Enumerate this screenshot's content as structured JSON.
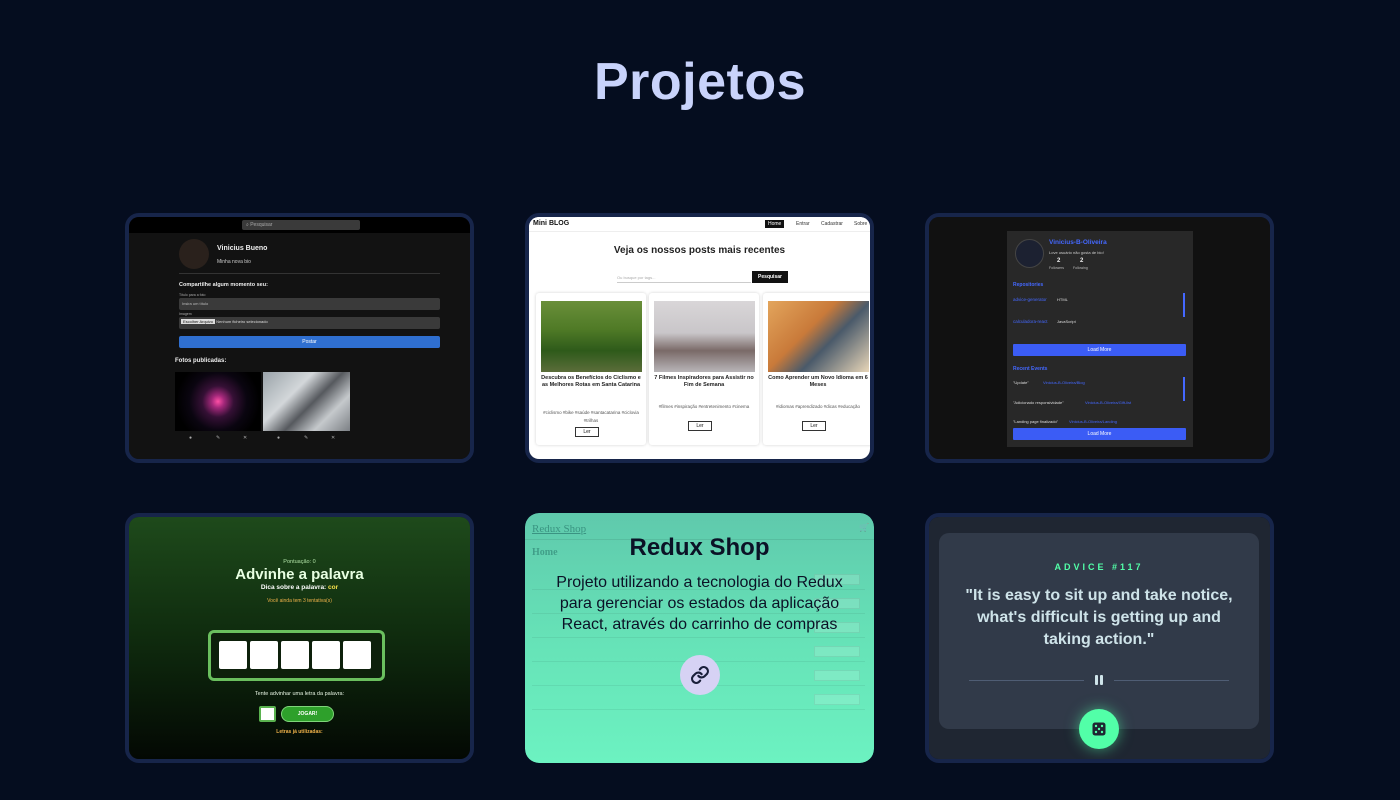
{
  "title": "Projetos",
  "projects": [
    {
      "profile_name": "Vinicius Bueno",
      "bio": "Minha nova bio",
      "search_placeholder": "Pesquisar",
      "share_heading": "Compartilhe algum momento seu:",
      "caption_label": "Título para a foto",
      "caption_placeholder": "Insira um título",
      "image_label": "Imagem",
      "file_button": "Escolher Arquivo",
      "file_status": "Nenhum ficheiro selecionado",
      "post_button": "Postar",
      "published_heading": "Fotos publicadas:"
    },
    {
      "brand": "Mini BLOG",
      "nav": [
        "Home",
        "Entrar",
        "Cadastrar",
        "Sobre"
      ],
      "heading": "Veja os nossos posts mais recentes",
      "search_placeholder": "Ou busque por tags...",
      "search_button": "Pesquisar",
      "read_label": "Ler",
      "posts": [
        {
          "title": "Descubra os Benefícios do Ciclismo e as Melhores Rotas em Santa Catarina",
          "tags": "#ciclismo #bike #saúde #santacatarina #ciclovia #trilhas"
        },
        {
          "title": "7 Filmes Inspiradores para Assistir no Fim de Semana",
          "tags": "#filmes #inspiração #entretenimento #cinema"
        },
        {
          "title": "Como Aprender um Novo Idioma em 6 Meses",
          "tags": "#idiomas #aprendizado #dicas #educação"
        }
      ]
    },
    {
      "username": "Vinicius-B-Oliveira",
      "bio": "Love usuário não gosta de bio!",
      "followers_count": "2",
      "followers_label": "Followers",
      "following_count": "2",
      "following_label": "Following",
      "repos_heading": "Repositories",
      "repos": [
        {
          "name": "advice-generator",
          "lang": "HTML"
        },
        {
          "name": "calculadora-react",
          "lang": "JavaScript"
        }
      ],
      "load_more": "Load More",
      "events_heading": "Recent Events",
      "events": [
        {
          "message": "\"Update\"",
          "repo": "Vinicius-B-Oliveira/Blog"
        },
        {
          "message": "\"Adicionado responsividade\"",
          "repo": "Vinicius-B-Oliveira/Gift-list"
        },
        {
          "message": "\"Landing page finalizado\"",
          "repo": "Vinicius-B-Oliveira/Landing"
        }
      ]
    },
    {
      "score": "Pontuação: 0",
      "heading": "Advinhe a palavra",
      "hint_label": "Dica sobre a palavra:",
      "hint_value": "cor",
      "attempts": "Você ainda tem 3 tentativa(s)",
      "guess_label": "Tente advinhar uma letra da palavra:",
      "play_button": "JOGAR!",
      "used_letters": "Letras já utilizadas:"
    },
    {
      "app_name": "Redux Shop",
      "page": "Home",
      "overlay_title": "Redux Shop",
      "overlay_desc": "Projeto utilizando a tecnologia do Redux para gerenciar os estados da aplicação React, através do carrinho de compras"
    },
    {
      "advice_number": "ADVICE #117",
      "quote": "\"It is easy to sit up and take notice, what's difficult is getting up and taking action.\""
    }
  ],
  "colors": {
    "background": "#050d1f",
    "title": "#c9d3fb",
    "card_border": "#17254a",
    "advice_accent": "#52ffa8",
    "github_link": "#4468ff",
    "redux_overlay": "#66e2b7"
  },
  "icons": [
    "search-icon",
    "eye-icon",
    "pencil-icon",
    "close-icon",
    "link-icon",
    "dice-icon",
    "pause-icon",
    "cart-icon"
  ]
}
